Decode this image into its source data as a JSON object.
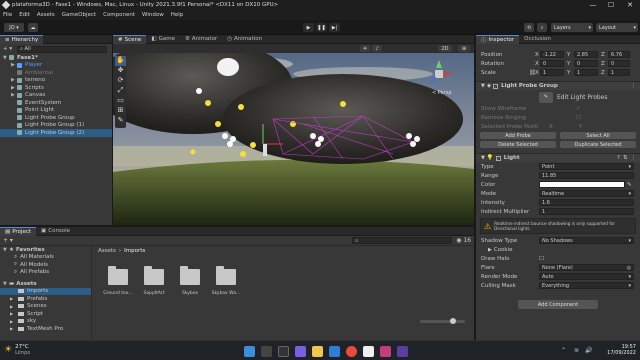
{
  "window": {
    "title": "plataforma3D - Fase1 - Windows, Mac, Linux - Unity 2021.3.9f1 Personal* <DX11 on DX10 GPU>",
    "minimize": "—",
    "maximize": "☐",
    "close": "✕"
  },
  "menu": [
    "File",
    "Edit",
    "Assets",
    "GameObject",
    "Component",
    "Window",
    "Help"
  ],
  "toolbar": {
    "account": "JO ▾",
    "cloud": "☁",
    "play": "▶",
    "pause": "❚❚",
    "step": "▶|",
    "layers": "Layers",
    "layout": "Layout"
  },
  "hierarchy": {
    "tab": "Hierarchy",
    "add": "+ ▾",
    "search_placeholder": "All",
    "items": [
      {
        "label": "Fase1*",
        "depth": 0,
        "arrow": "▼"
      },
      {
        "label": "Player",
        "depth": 1,
        "arrow": "▶",
        "color": "#5aa0ff"
      },
      {
        "label": "Ambiental",
        "depth": 1,
        "arrow": "",
        "color": "#777"
      },
      {
        "label": "terreno",
        "depth": 1,
        "arrow": "▶"
      },
      {
        "label": "Scripts",
        "depth": 1,
        "arrow": "▶"
      },
      {
        "label": "Canvas",
        "depth": 1,
        "arrow": "▶"
      },
      {
        "label": "EventSystem",
        "depth": 1,
        "arrow": ""
      },
      {
        "label": "Point Light",
        "depth": 1,
        "arrow": ""
      },
      {
        "label": "Light Probe Group",
        "depth": 1,
        "arrow": ""
      },
      {
        "label": "Light Probe Group (1)",
        "depth": 1,
        "arrow": ""
      },
      {
        "label": "Light Probe Group (2)",
        "depth": 1,
        "arrow": "",
        "selected": true
      }
    ]
  },
  "scene_tabs": [
    "Scene",
    "Game",
    "Animator",
    "Animation"
  ],
  "scene_toolbar": {
    "persp": "< Persp",
    "mode2d": "2D"
  },
  "project": {
    "tabs": [
      "Project",
      "Console"
    ],
    "add": "+ ▾",
    "favorites_title": "Favorites",
    "favorites": [
      "All Materials",
      "All Models",
      "All Prefabs"
    ],
    "assets_title": "Assets",
    "assets": [
      "Imports",
      "Prefabs",
      "Scenes",
      "Script",
      "sky",
      "TextMesh Pro"
    ],
    "breadcrumb": [
      "Assets",
      "Imports"
    ],
    "count": "16",
    "folders": [
      "Ground tex...",
      "SappltArt",
      "Skybox",
      "Skybox Wa..."
    ]
  },
  "inspector": {
    "tabs": [
      "Inspector",
      "Occlusion"
    ],
    "transform": {
      "position": {
        "label": "Position",
        "x": "-1.22",
        "y": "2.85",
        "z": "6.76"
      },
      "rotation": {
        "label": "Rotation",
        "x": "0",
        "y": "0",
        "z": "0"
      },
      "scale": {
        "label": "Scale",
        "x": "1",
        "y": "1",
        "z": "1"
      }
    },
    "light_probe_group": {
      "title": "Light Probe Group",
      "edit_button": "Edit Light Probes",
      "show_wireframe": "Show Wireframe",
      "remove_ringing": "Remove Ringing",
      "selected_pos": "Selected Probe Positi",
      "selected_pos_x": "X",
      "selected_pos_y": "Y",
      "add_probe": "Add Probe",
      "select_all": "Select All",
      "delete_selected": "Delete Selected",
      "duplicate_selected": "Duplicate Selected"
    },
    "light": {
      "title": "Light",
      "type_label": "Type",
      "type_value": "Point",
      "range_label": "Range",
      "range_value": "11.85",
      "color_label": "Color",
      "mode_label": "Mode",
      "mode_value": "Realtime",
      "intensity_label": "Intensity",
      "intensity_value": "1.6",
      "indirect_label": "Indirect Multiplier",
      "indirect_value": "1",
      "warning": "Realtime indirect bounce shadowing is only supported for Directional lights.",
      "shadow_label": "Shadow Type",
      "shadow_value": "No Shadows",
      "cookie_label": "Cookie",
      "halo_label": "Draw Halo",
      "flare_label": "Flare",
      "flare_value": "None (Flare)",
      "render_mode_label": "Render Mode",
      "render_mode_value": "Auto",
      "culling_label": "Culling Mask",
      "culling_value": "Everything"
    },
    "add_component": "Add Component"
  },
  "taskbar": {
    "weather_temp": "27°C",
    "weather_desc": "Limpo",
    "time": "19:57",
    "date": "17/09/2022"
  },
  "colors": {
    "accent": "#4a8dd6",
    "selection": "#2c5d87",
    "probe_yellow": "#f3e03a",
    "probe_magenta": "#c03cc0",
    "warning": "#f0c000"
  }
}
